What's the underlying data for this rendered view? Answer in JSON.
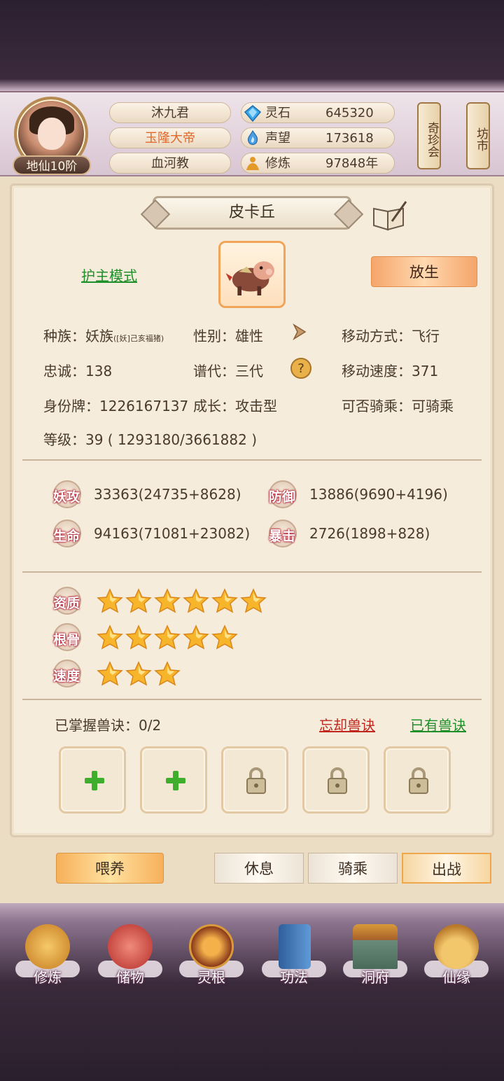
{
  "player": {
    "rank": "地仙10阶",
    "name": "沐九君",
    "title": "玉隆大帝",
    "sect": "血河教",
    "stats": [
      {
        "label": "灵石",
        "value": "645320",
        "icon": "diamond-icon",
        "color": "#3aa7e8"
      },
      {
        "label": "声望",
        "value": "173618",
        "icon": "flame-icon",
        "color": "#4b9fe0"
      },
      {
        "label": "修炼",
        "value": "97848年",
        "icon": "meditate-icon",
        "color": "#e49a2b"
      }
    ],
    "side_buttons": [
      "奇珍会",
      "坊市"
    ]
  },
  "pet": {
    "name": "皮卡丘",
    "mode_link": "护主模式",
    "release_label": "放生",
    "info": {
      "race_label": "种族：",
      "race_value": "妖族",
      "race_detail": "([妖]己亥福猪)",
      "gender": "性别：雄性",
      "move_type": "移动方式：飞行",
      "loyalty": "忠诚：138",
      "generation": "谱代：三代",
      "move_speed": "移动速度：371",
      "id_tag": "身份牌：1226167137",
      "growth": "成长：攻击型",
      "rideable": "可否骑乘：可骑乘",
      "level": "等级：39 ( 1293180/3661882 )"
    },
    "attributes": [
      {
        "badge": "妖攻",
        "value": "33363(24735+8628)"
      },
      {
        "badge": "防御",
        "value": "13886(9690+4196)"
      },
      {
        "badge": "生命",
        "value": "94163(71081+23082)"
      },
      {
        "badge": "暴击",
        "value": "2726(1898+828)"
      }
    ],
    "ratings": [
      {
        "badge": "资质",
        "stars": 6
      },
      {
        "badge": "根骨",
        "stars": 5
      },
      {
        "badge": "速度",
        "stars": 3
      }
    ],
    "skills": {
      "mastered": "已掌握兽诀：0/2",
      "forget_link": "忘却兽诀",
      "owned_link": "已有兽诀",
      "slots": [
        "add",
        "add",
        "locked",
        "locked",
        "locked"
      ]
    }
  },
  "actions": {
    "feed": "喂养",
    "rest": "休息",
    "ride": "骑乘",
    "battle": "出战"
  },
  "nav": [
    {
      "label": "修炼",
      "icon": "cultivate-icon",
      "color": "#e0a23a"
    },
    {
      "label": "储物",
      "icon": "bag-icon",
      "color": "#d8504a"
    },
    {
      "label": "灵根",
      "icon": "spirit-root-icon",
      "color": "#d87a2a"
    },
    {
      "label": "功法",
      "icon": "book-icon",
      "color": "#3e7ab8"
    },
    {
      "label": "洞府",
      "icon": "mansion-icon",
      "color": "#c8902c"
    },
    {
      "label": "仙缘",
      "icon": "gourd-icon",
      "color": "#d8a040"
    }
  ]
}
